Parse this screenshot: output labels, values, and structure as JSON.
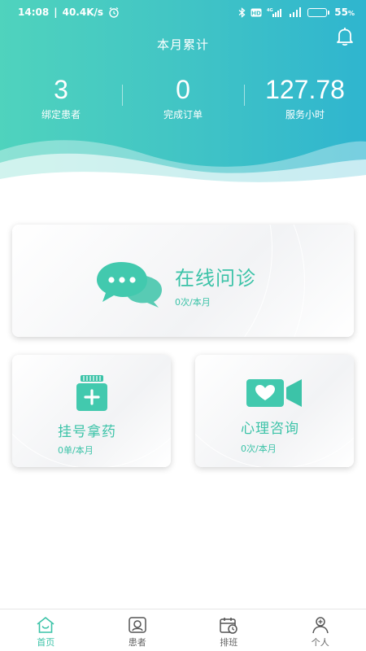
{
  "status_bar": {
    "time": "14:08",
    "network_speed": "40.4K/s",
    "battery_percent": "55",
    "battery_level": 0.55,
    "icons": [
      "alarm-icon",
      "bluetooth-icon",
      "hd-icon",
      "4g-icon",
      "signal-icon",
      "battery-icon"
    ]
  },
  "header": {
    "title": "本月累计",
    "bell_icon": "bell-icon"
  },
  "stats": [
    {
      "value": "3",
      "label": "绑定患者"
    },
    {
      "value": "0",
      "label": "完成订单"
    },
    {
      "value": "127.78",
      "label": "服务小时"
    }
  ],
  "cards": {
    "online": {
      "title": "在线问诊",
      "subtitle": "0次/本月",
      "icon": "chat-bubbles-icon"
    },
    "register": {
      "title": "挂号拿药",
      "subtitle": "0单/本月",
      "icon": "medicine-bottle-icon"
    },
    "psych": {
      "title": "心理咨询",
      "subtitle": "0次/本月",
      "icon": "video-heart-icon"
    }
  },
  "tabs": [
    {
      "label": "首页",
      "icon": "home-icon",
      "active": true
    },
    {
      "label": "患者",
      "icon": "patient-icon",
      "active": false
    },
    {
      "label": "排班",
      "icon": "calendar-clock-icon",
      "active": false
    },
    {
      "label": "个人",
      "icon": "person-icon",
      "active": false
    }
  ],
  "colors": {
    "accent": "#3cc3a8",
    "header_start": "#4fd3bd",
    "header_end": "#2fb5cf"
  }
}
